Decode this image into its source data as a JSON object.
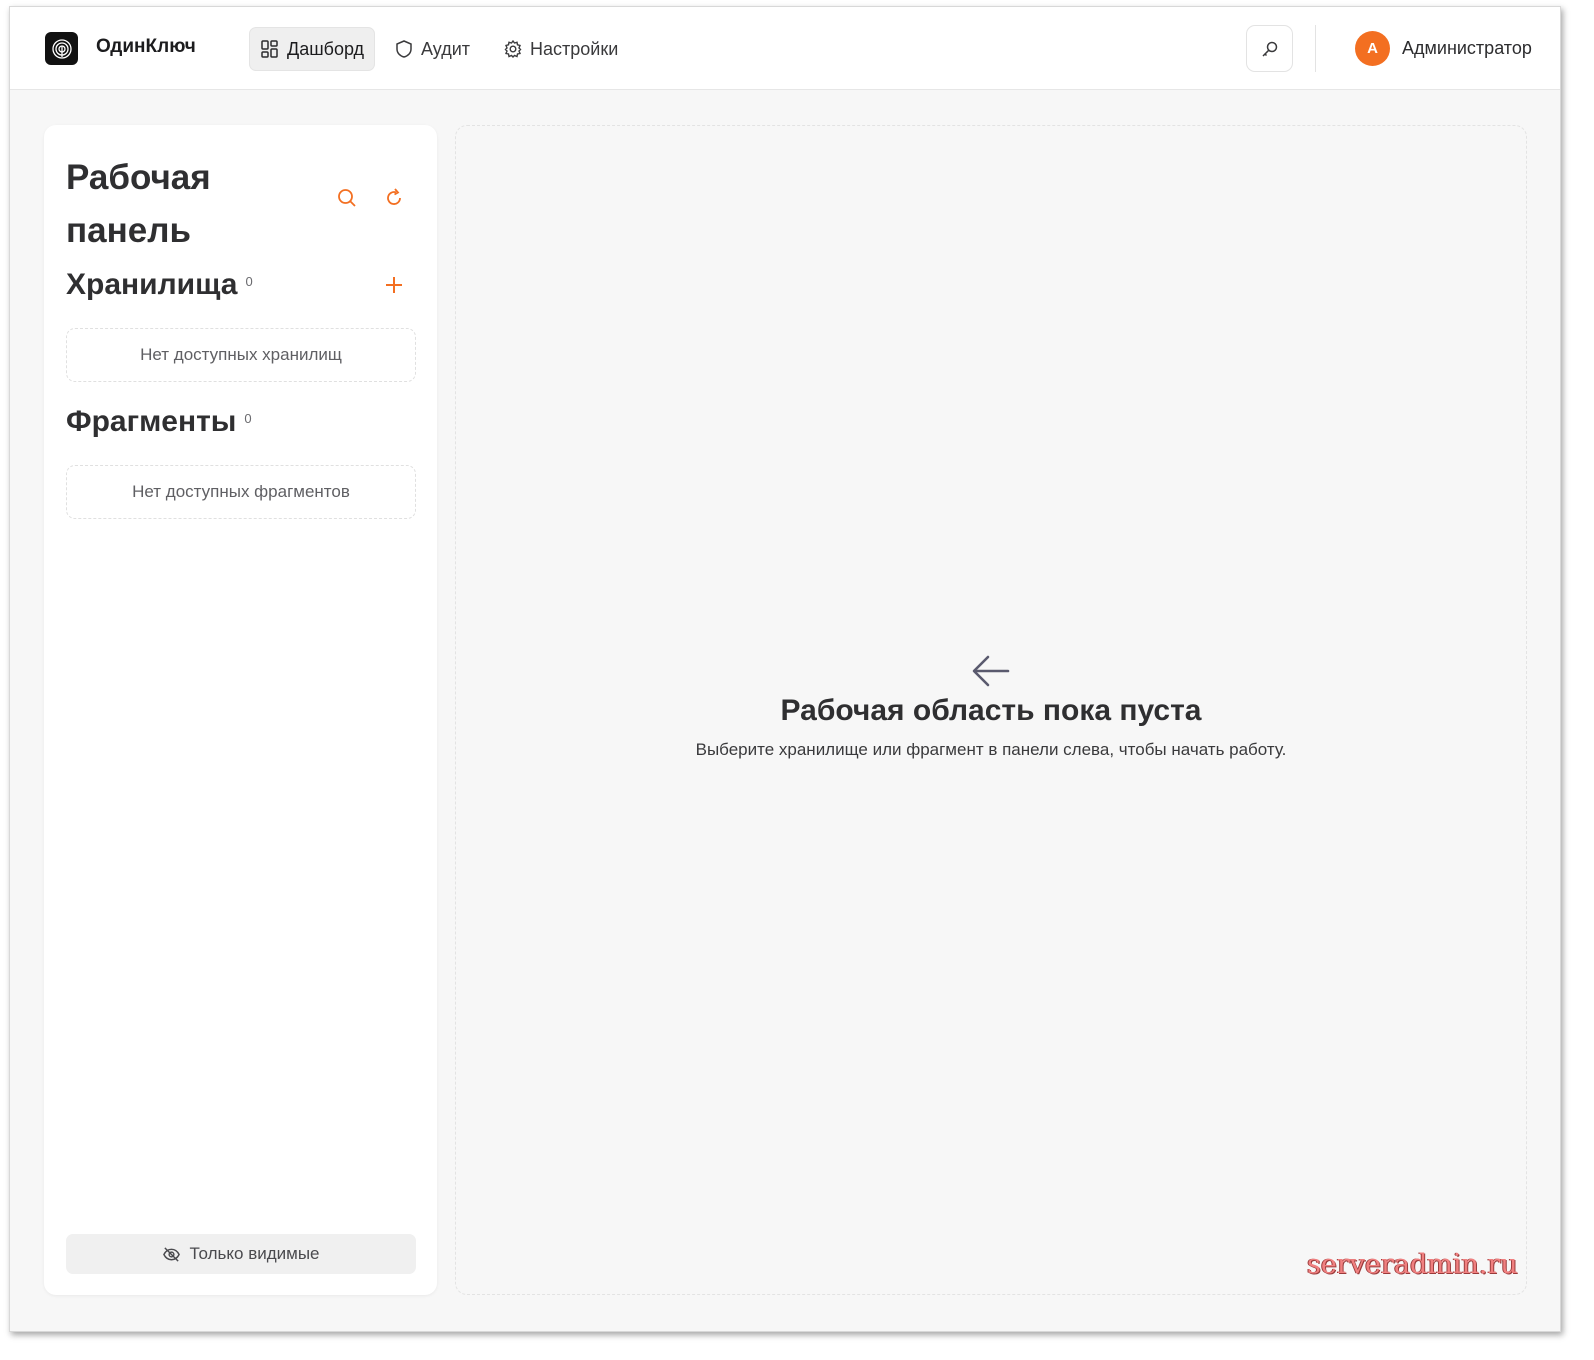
{
  "app": {
    "brand": "ОдинКлюч"
  },
  "nav": [
    {
      "label": "Дашборд",
      "icon": "dashboard-icon",
      "active": true
    },
    {
      "label": "Аудит",
      "icon": "shield-icon",
      "active": false
    },
    {
      "label": "Настройки",
      "icon": "gear-icon",
      "active": false
    }
  ],
  "user": {
    "avatar_letter": "A",
    "name": "Администратор"
  },
  "sidebar": {
    "title": "Рабочая панель",
    "vaults": {
      "title": "Хранилища",
      "count": "0",
      "empty": "Нет доступных хранилищ"
    },
    "fragments": {
      "title": "Фрагменты",
      "count": "0",
      "empty": "Нет доступных фрагментов"
    },
    "visible_only": "Только видимые"
  },
  "main": {
    "empty_title": "Рабочая область пока пуста",
    "empty_subtitle": "Выберите хранилище или фрагмент в панели слева, чтобы начать работу."
  },
  "watermark": "serveradmin.ru",
  "colors": {
    "accent": "#f36f21",
    "background": "#f7f7f7",
    "panel": "#ffffff"
  }
}
